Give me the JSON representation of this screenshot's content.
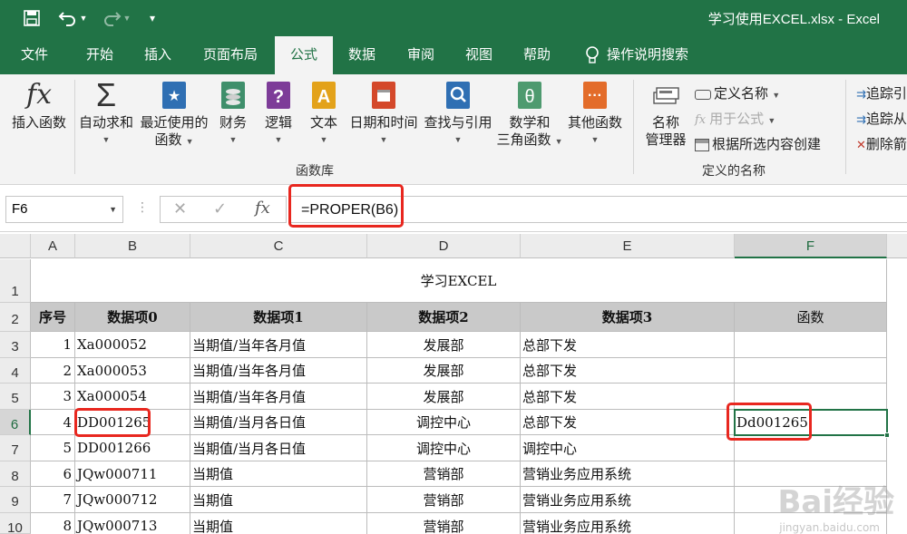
{
  "window": {
    "title": "学习使用EXCEL.xlsx  -  Excel"
  },
  "tabs": [
    "文件",
    "开始",
    "插入",
    "页面布局",
    "公式",
    "数据",
    "审阅",
    "视图",
    "帮助",
    "操作说明搜索"
  ],
  "ribbon": {
    "insert_function": "插入函数",
    "autosum": "自动求和",
    "recent": [
      "最近使用的",
      "函数"
    ],
    "financial": "财务",
    "logical": "逻辑",
    "text": "文本",
    "datetime": "日期和时间",
    "lookup": "查找与引用",
    "math": [
      "数学和",
      "三角函数"
    ],
    "other": "其他函数",
    "group_library": "函数库",
    "name_manager": [
      "名称",
      "管理器"
    ],
    "define_name": "定义名称",
    "use_in_formula": "用于公式",
    "create_from_selection": "根据所选内容创建",
    "group_defined_names": "定义的名称",
    "trace_precedents": "追踪引",
    "trace_dependents": "追踪从",
    "remove_arrows": "删除箭"
  },
  "formula_bar": {
    "name_box": "F6",
    "formula": "=PROPER(B6)"
  },
  "columns": [
    "A",
    "B",
    "C",
    "D",
    "E",
    "F"
  ],
  "rows": [
    "1",
    "2",
    "3",
    "4",
    "5",
    "6",
    "7",
    "8",
    "9",
    "10"
  ],
  "sheet": {
    "title": "学习EXCEL",
    "headers": [
      "序号",
      "数据项0",
      "数据项1",
      "数据项2",
      "数据项3",
      "函数"
    ],
    "data": [
      [
        "1",
        "Xa000052",
        "当期值/当年各月值",
        "发展部",
        "总部下发",
        ""
      ],
      [
        "2",
        "Xa000053",
        "当期值/当年各月值",
        "发展部",
        "总部下发",
        ""
      ],
      [
        "3",
        "Xa000054",
        "当期值/当年各月值",
        "发展部",
        "总部下发",
        ""
      ],
      [
        "4",
        "DD001265",
        "当期值/当月各日值",
        "调控中心",
        "总部下发",
        "Dd001265"
      ],
      [
        "5",
        "DD001266",
        "当期值/当月各日值",
        "调控中心",
        "调控中心",
        ""
      ],
      [
        "6",
        "JQw000711",
        "当期值",
        "营销部",
        "营销业务应用系统",
        ""
      ],
      [
        "7",
        "JQw000712",
        "当期值",
        "营销部",
        "营销业务应用系统",
        ""
      ],
      [
        "8",
        "JQw000713",
        "当期值",
        "营销部",
        "营销业务应用系统",
        ""
      ]
    ]
  },
  "watermark": {
    "main": "Bai经验",
    "sub": "jingyan.baidu.com"
  },
  "colors": {
    "excel_green": "#217346",
    "highlight_red": "#e8271f"
  }
}
